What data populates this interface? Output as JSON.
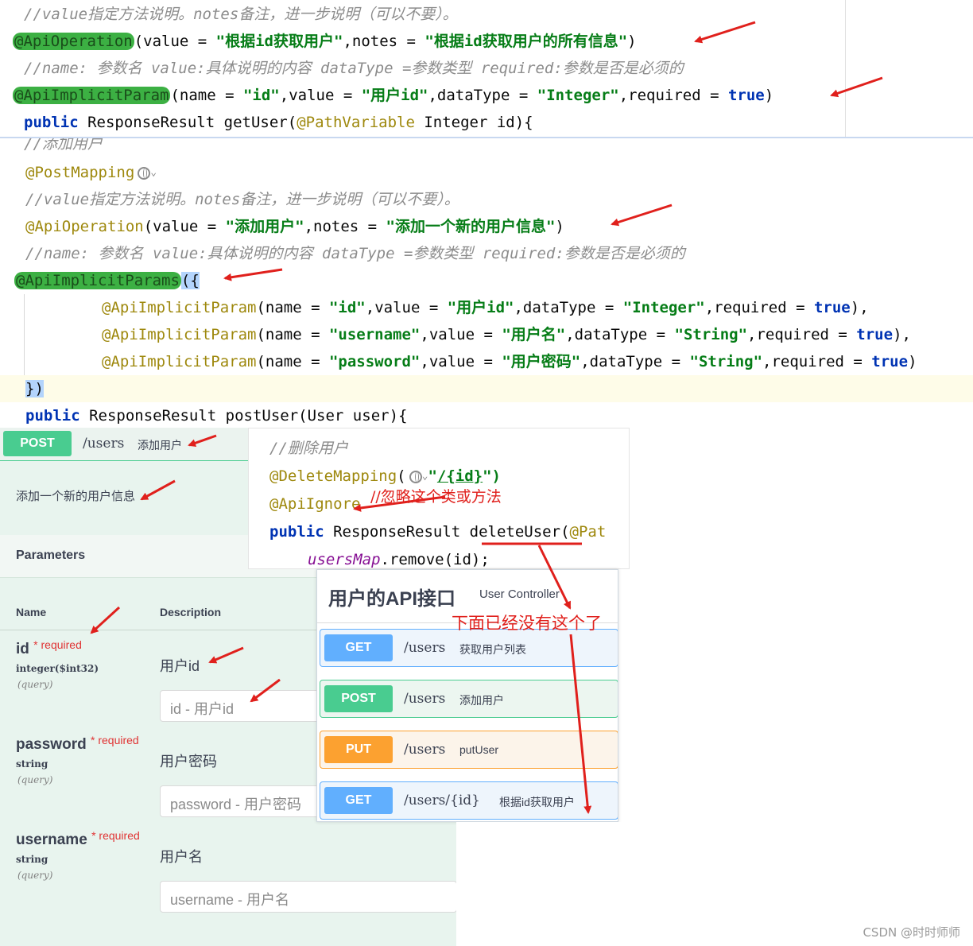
{
  "code_top": {
    "comment_value": "//value指定方法说明。notes备注，进一步说明（可以不要）。",
    "api_operation": {
      "annotation": "@ApiOperation",
      "rest_prefix": "(value = ",
      "value": "\"根据id获取用户\"",
      "mid": ",notes = ",
      "notes": "\"根据id获取用户的所有信息\"",
      "end": ")"
    },
    "comment_name": "//name: 参数名 value:具体说明的内容 dataType =参数类型 required:参数是否是必须的",
    "implicit_param": {
      "annotation": "@ApiImplicitParam",
      "p1": "(name = ",
      "name": "\"id\"",
      "p2": ",value = ",
      "value": "\"用户id\"",
      "p3": ",dataType = ",
      "type": "\"Integer\"",
      "p4": ",required = ",
      "required": "true",
      "p5": ")"
    },
    "method": {
      "kw": "public",
      "rest1": " ResponseResult getUser(",
      "ann": "@PathVariable",
      "rest2": " Integer id){"
    }
  },
  "code_mid": {
    "comment_add": "//添加用户",
    "post_mapping": "@PostMapping",
    "comment_value": "//value指定方法说明。notes备注，进一步说明（可以不要）。",
    "api_operation": {
      "annotation": "@ApiOperation",
      "rest_prefix": "(value = ",
      "value": "\"添加用户\"",
      "mid": ",notes = ",
      "notes": "\"添加一个新的用户信息\"",
      "end": ")"
    },
    "comment_name": "//name: 参数名 value:具体说明的内容 dataType =参数类型 required:参数是否是必须的",
    "implicit_params": "@ApiImplicitParams",
    "implicit_params_open": "({",
    "params": [
      {
        "annotation": "@ApiImplicitParam",
        "p1": "(name = ",
        "name": "\"id\"",
        "p2": ",value = ",
        "value": "\"用户id\"",
        "p3": ",dataType = ",
        "type": "\"Integer\"",
        "p4": ",required = ",
        "required": "true",
        "p5": "),"
      },
      {
        "annotation": "@ApiImplicitParam",
        "p1": "(name = ",
        "name": "\"username\"",
        "p2": ",value = ",
        "value": "\"用户名\"",
        "p3": ",dataType = ",
        "type": "\"String\"",
        "p4": ",required = ",
        "required": "true",
        "p5": "),"
      },
      {
        "annotation": "@ApiImplicitParam",
        "p1": "(name = ",
        "name": "\"password\"",
        "p2": ",value = ",
        "value": "\"用户密码\"",
        "p3": ",dataType = ",
        "type": "\"String\"",
        "p4": ",required = ",
        "required": "true",
        "p5": ")"
      }
    ],
    "close": "})",
    "method": {
      "kw": "public",
      "rest": " ResponseResult postUser(User user){"
    }
  },
  "swagger_left": {
    "method": "POST",
    "path": "/users",
    "summary": "添加用户",
    "description": "添加一个新的用户信息",
    "parameters_title": "Parameters",
    "col_name": "Name",
    "col_desc": "Description",
    "required_label": "required",
    "params": [
      {
        "name": "id",
        "type": "integer($int32)",
        "in": "(query)",
        "desc": "用户id",
        "placeholder": "id - 用户id"
      },
      {
        "name": "password",
        "type": "string",
        "in": "(query)",
        "desc": "用户密码",
        "placeholder": "password - 用户密码"
      },
      {
        "name": "username",
        "type": "string",
        "in": "(query)",
        "desc": "用户名",
        "placeholder": "username - 用户名"
      }
    ]
  },
  "delete_snippet": {
    "comment": "//删除用户",
    "mapping": "@DeleteMapping",
    "mapping_rest": "(",
    "mapping_path_q1": "\"",
    "mapping_path": "/{id}",
    "mapping_path_q2": "\")",
    "ignore": "@ApiIgnore",
    "ignore_note": "//忽略这个类或方法",
    "method_kw": "public",
    "method_rest1": " ResponseResult ",
    "method_name": "deleteUser",
    "method_rest2": "(",
    "method_ann": "@Pat",
    "body_var": "usersMap",
    "body_rest": ".remove(id);"
  },
  "api_list": {
    "title": "用户的API接口",
    "subtitle": "User Controller",
    "annotation": "下面已经没有这个了",
    "ops": [
      {
        "method": "GET",
        "path": "/users",
        "summary": "获取用户列表"
      },
      {
        "method": "POST",
        "path": "/users",
        "summary": "添加用户"
      },
      {
        "method": "PUT",
        "path": "/users",
        "summary": "putUser"
      },
      {
        "method": "GET",
        "path": "/users/{id}",
        "summary": "根据id获取用户"
      }
    ]
  },
  "watermark": "CSDN @时时师师",
  "colors": {
    "annotation": "#9e880d",
    "string": "#067d17",
    "keyword": "#0033b3",
    "comment": "#8c8c8c",
    "highlight": "#3cb043",
    "arrow": "#e0201c",
    "post": "#49cc90",
    "get": "#61affe",
    "put": "#fca130"
  }
}
